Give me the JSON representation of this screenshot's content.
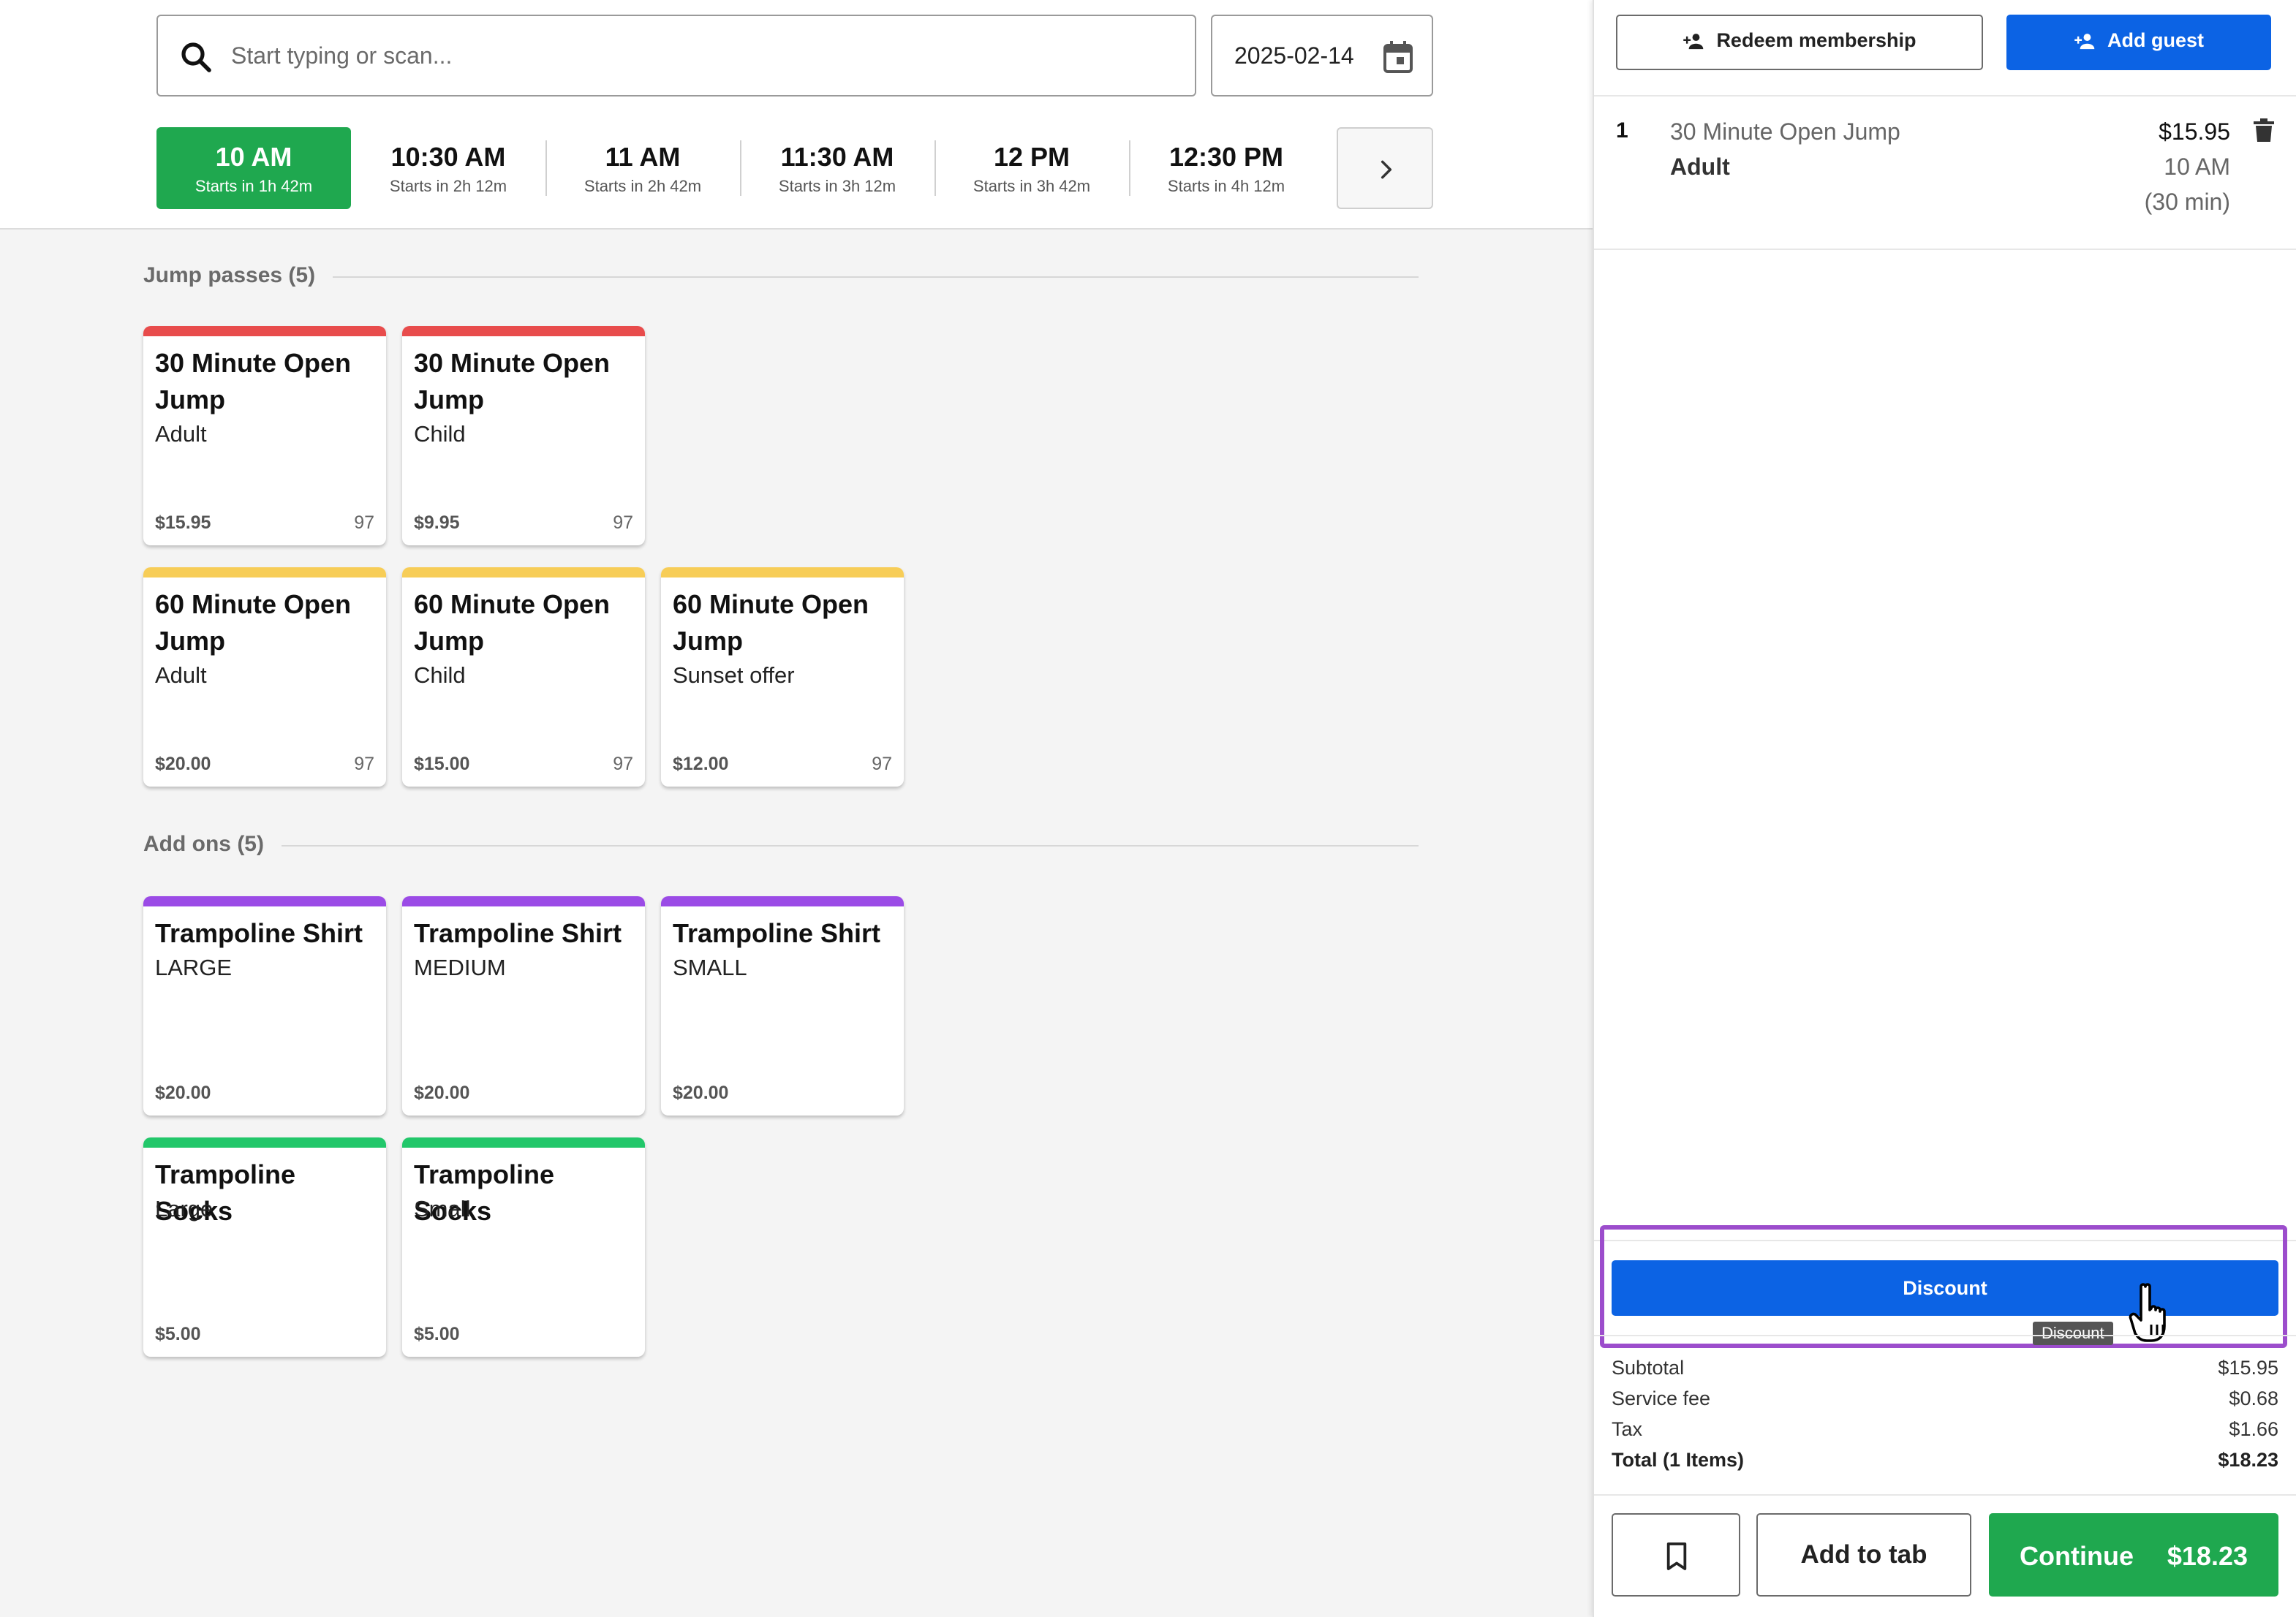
{
  "search": {
    "placeholder": "Start typing or scan...",
    "date": "2025-02-14"
  },
  "timeslots": [
    {
      "time": "10 AM",
      "sub": "Starts in 1h 42m",
      "active": true
    },
    {
      "time": "10:30 AM",
      "sub": "Starts in 2h 12m",
      "active": false
    },
    {
      "time": "11 AM",
      "sub": "Starts in 2h 42m",
      "active": false
    },
    {
      "time": "11:30 AM",
      "sub": "Starts in 3h 12m",
      "active": false
    },
    {
      "time": "12 PM",
      "sub": "Starts in 3h 42m",
      "active": false
    },
    {
      "time": "12:30 PM",
      "sub": "Starts in 4h 12m",
      "active": false
    }
  ],
  "sections": {
    "jump_passes": {
      "title": "Jump passes (5)"
    },
    "add_ons": {
      "title": "Add ons (5)"
    }
  },
  "products": {
    "jump_passes": [
      {
        "title": "30 Minute Open Jump",
        "sub": "Adult",
        "price": "$15.95",
        "stock": "97",
        "color": "#e84c4c"
      },
      {
        "title": "30 Minute Open Jump",
        "sub": "Child",
        "price": "$9.95",
        "stock": "97",
        "color": "#e84c4c"
      },
      {
        "title": "60 Minute Open Jump",
        "sub": "Adult",
        "price": "$20.00",
        "stock": "97",
        "color": "#f7cd57"
      },
      {
        "title": "60 Minute Open Jump",
        "sub": "Child",
        "price": "$15.00",
        "stock": "97",
        "color": "#f7cd57"
      },
      {
        "title": "60 Minute Open Jump",
        "sub": "Sunset offer",
        "price": "$12.00",
        "stock": "97",
        "color": "#f7cd57"
      }
    ],
    "add_ons": [
      {
        "title": "Trampoline Shirt",
        "sub": "LARGE",
        "price": "$20.00",
        "color": "#9b4be6"
      },
      {
        "title": "Trampoline Shirt",
        "sub": "MEDIUM",
        "price": "$20.00",
        "color": "#9b4be6"
      },
      {
        "title": "Trampoline Shirt",
        "sub": "SMALL",
        "price": "$20.00",
        "color": "#9b4be6"
      },
      {
        "title": "Trampoline Socks",
        "sub": "Large",
        "price": "$5.00",
        "color": "#22c76a"
      },
      {
        "title": "Trampoline Socks",
        "sub": "Small",
        "price": "$5.00",
        "color": "#22c76a"
      }
    ]
  },
  "cart": {
    "redeem_label": "Redeem membership",
    "add_guest_label": "Add guest",
    "line": {
      "qty": "1",
      "name": "30 Minute Open Jump",
      "variant": "Adult",
      "price": "$15.95",
      "time": "10 AM",
      "duration": "(30 min)"
    },
    "discount_label": "Discount",
    "discount_tooltip": "Discount",
    "summary": [
      {
        "label": "Subtotal",
        "value": "$15.95"
      },
      {
        "label": "Service fee",
        "value": "$0.68"
      },
      {
        "label": "Tax",
        "value": "$1.66"
      },
      {
        "label": "Total (1 Items)",
        "value": "$18.23"
      }
    ],
    "add_to_tab_label": "Add to tab",
    "continue_label": "Continue",
    "continue_total": "$18.23"
  },
  "colors": {
    "accent_blue": "#0c63e4",
    "accent_green": "#1fa84f",
    "highlight_purple": "#9c4dcc"
  },
  "icons": [
    "search-icon",
    "calendar-icon",
    "chevron-right-icon",
    "add-person-icon",
    "trash-icon",
    "bookmark-icon",
    "hand-cursor-icon"
  ]
}
